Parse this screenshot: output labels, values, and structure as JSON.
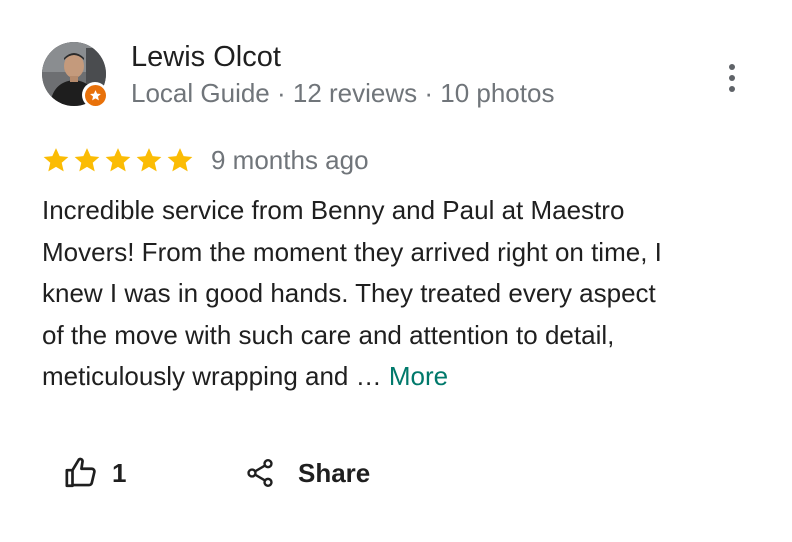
{
  "reviewer": {
    "name": "Lewis Olcot",
    "meta": "Local Guide · 12 reviews · 10 photos",
    "avatar_icon": "person-avatar",
    "badge_icon": "local-guide-star-badge",
    "badge_color": "#e8710a"
  },
  "review": {
    "rating": 5,
    "rating_max": 5,
    "star_color": "#fbbc04",
    "date": "9 months ago",
    "text_lines": [
      "Incredible service from Benny and Paul at Maestro",
      "Movers! From the moment they arrived right on time, I",
      "knew I was in good hands. They treated every aspect",
      "of the move with such care and attention to detail,",
      "meticulously wrapping and … "
    ],
    "more_label": "More",
    "more_color": "#00796b"
  },
  "actions": {
    "like_icon": "thumbs-up-icon",
    "like_count": "1",
    "share_icon": "share-icon",
    "share_label": "Share",
    "more_options_icon": "more-vert-icon"
  }
}
